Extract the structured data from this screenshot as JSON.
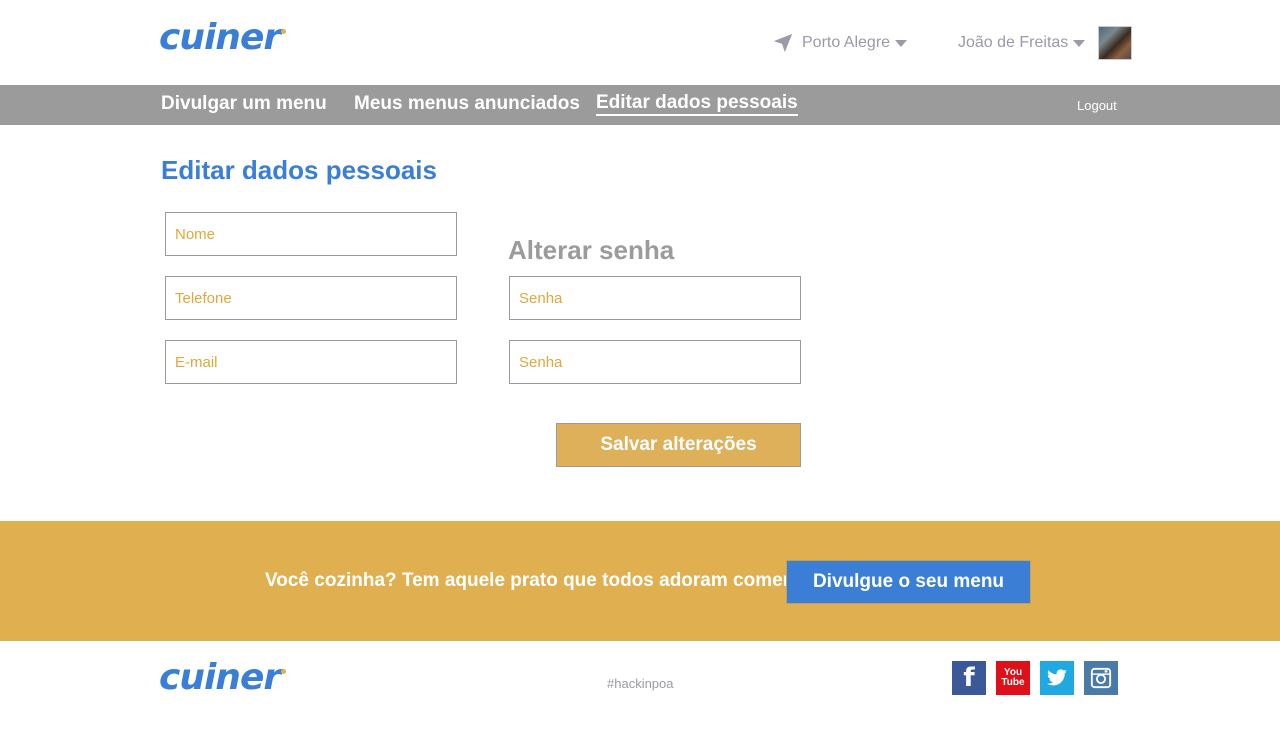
{
  "brand": {
    "logo_text": "cuiner"
  },
  "header": {
    "location": "Porto Alegre",
    "user_name": "João de Freitas"
  },
  "nav": {
    "items": [
      {
        "label": "Divulgar um menu"
      },
      {
        "label": "Meus menus anunciados"
      },
      {
        "label": "Editar dados pessoais"
      }
    ],
    "active_index": 2,
    "logout": "Logout"
  },
  "form": {
    "title": "Editar dados pessoais",
    "name_placeholder": "Nome",
    "phone_placeholder": "Telefone",
    "email_placeholder": "E-mail",
    "password_section_title": "Alterar senha",
    "password_placeholder": "Senha",
    "password_confirm_placeholder": "Senha",
    "save_label": "Salvar alterações"
  },
  "promo": {
    "text": "Você cozinha? Tem aquele prato que todos adoram comer?",
    "button_label": "Divulgue o seu menu"
  },
  "footer": {
    "hashtag": "#hackinpoa",
    "social": [
      {
        "name": "facebook-icon",
        "glyph": "f"
      },
      {
        "name": "youtube-icon",
        "glyph_top": "You",
        "glyph_bottom": "Tube"
      },
      {
        "name": "twitter-icon"
      },
      {
        "name": "instagram-icon"
      }
    ]
  },
  "colors": {
    "accent_blue": "#3a7fd5",
    "accent_gold": "#e0b050",
    "nav_gray": "#9b9b9b",
    "placeholder_orange": "#e0a83a"
  }
}
